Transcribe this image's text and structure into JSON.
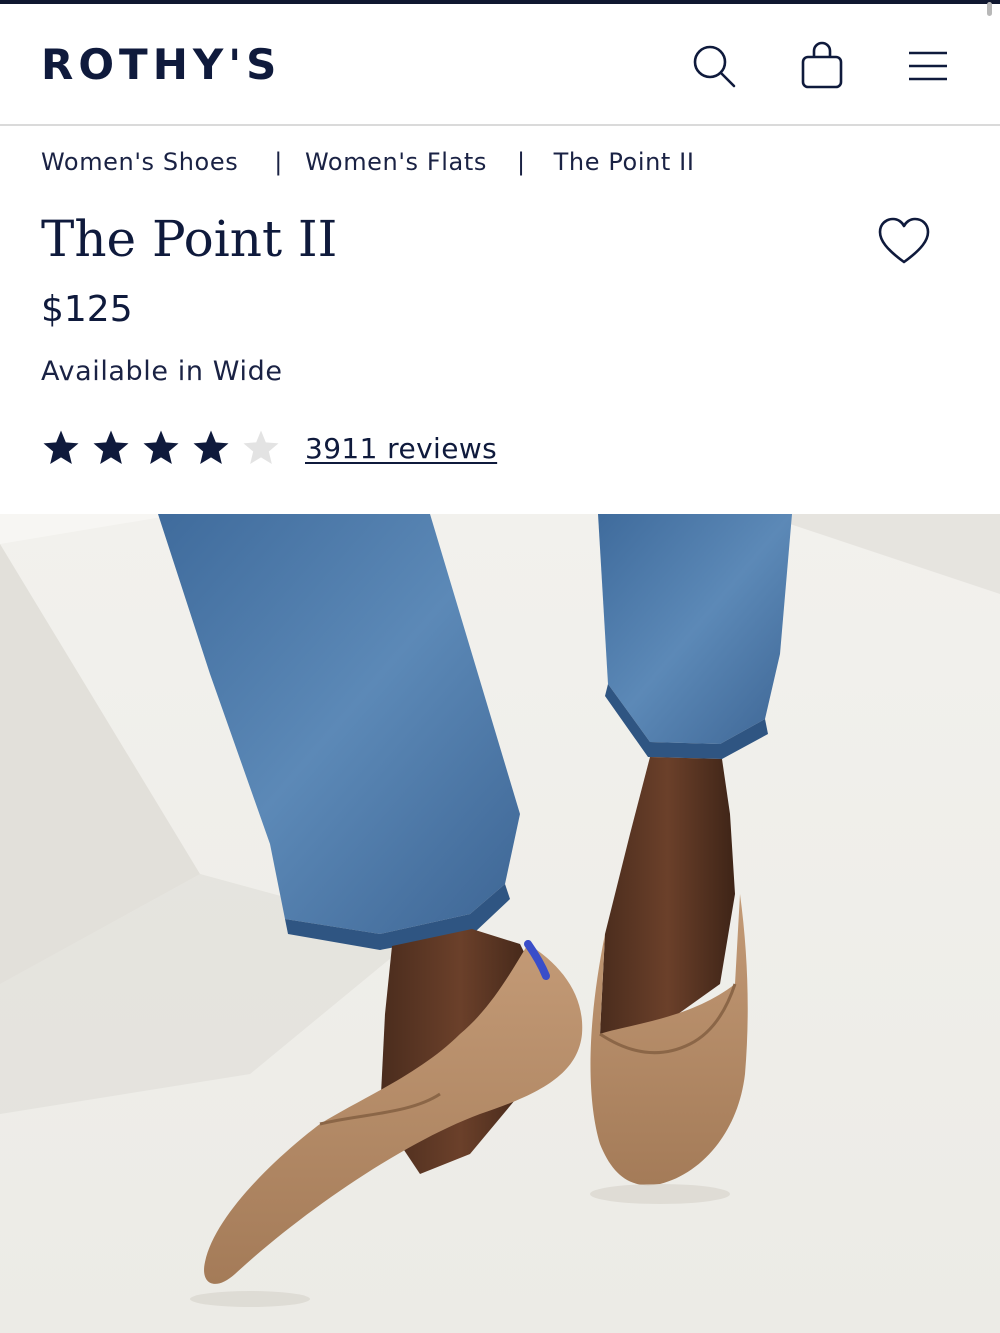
{
  "header": {
    "logo": "ROTHY'S",
    "icons": [
      "search-icon",
      "shopping-bag-icon",
      "menu-icon"
    ]
  },
  "breadcrumb": {
    "items": [
      "Women's Shoes",
      "Women's Flats",
      "The Point II"
    ],
    "separator": "|"
  },
  "product": {
    "title": "The Point II",
    "price": "$125",
    "availability": "Available in Wide",
    "rating": 4,
    "rating_max": 5,
    "reviews_label": "3911 reviews"
  },
  "colors": {
    "brand_navy": "#0f1a3c",
    "star_filled": "#0f1a3c",
    "star_empty": "#e3e3e3",
    "divider": "#dadada"
  },
  "hero_image": {
    "icon": "product-photo"
  }
}
